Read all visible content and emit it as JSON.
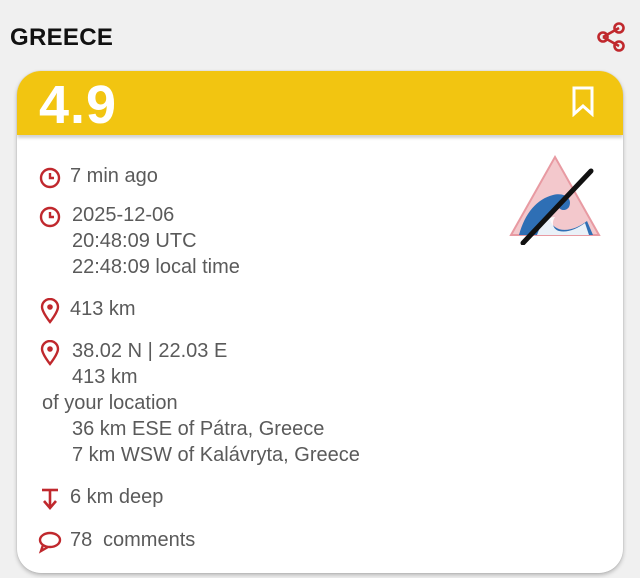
{
  "header": {
    "country": "GREECE",
    "share_icon": "share-icon"
  },
  "event": {
    "magnitude": "4.9",
    "time_ago": "7 min ago",
    "date": "2025-12-06",
    "utc_time": "20:48:09 UTC",
    "local_time": "22:48:09 local time",
    "distance": "413 km",
    "coordinates": "38.02 N | 22.03 E",
    "distance_line": "413 km",
    "distance_suffix": "of your location",
    "nearby_1": "36 km ESE of Pátra, Greece",
    "nearby_2": "7 km WSW of Kalávryta, Greece",
    "depth": "6 km deep",
    "comments_count": "78",
    "comments_label": "comments"
  },
  "icons": {
    "bookmark": "bookmark-icon",
    "clock": "clock-icon",
    "pin": "location-pin-icon",
    "depth": "depth-arrow-icon",
    "comment": "comment-bubble-icon",
    "tsunami": "no-tsunami-icon"
  },
  "colors": {
    "accent_red": "#c0282d",
    "magnitude_bar": "#f2c511",
    "text_gray": "#5a5a5a"
  }
}
